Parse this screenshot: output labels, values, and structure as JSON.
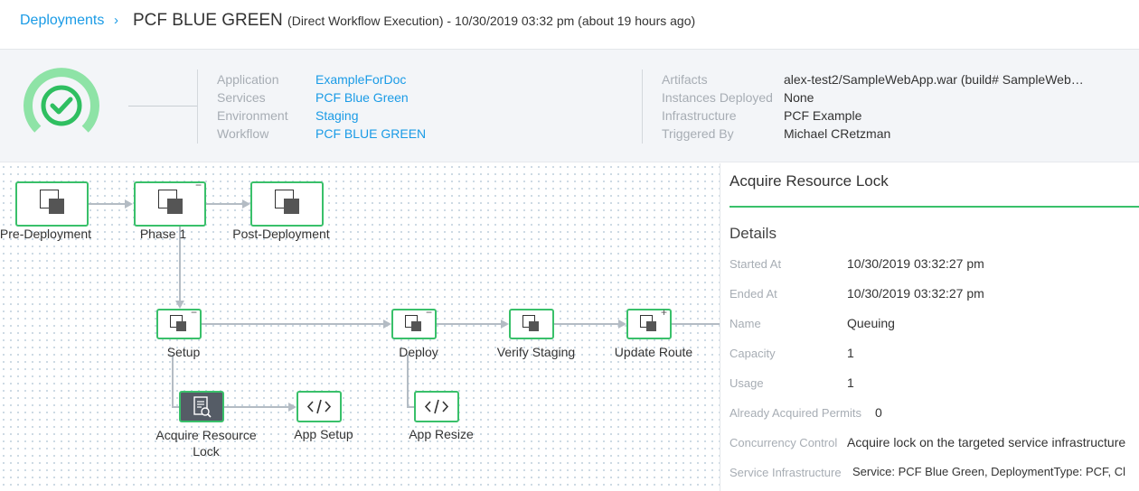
{
  "breadcrumb": {
    "parent": "Deployments",
    "separator": "›"
  },
  "header": {
    "title": "PCF BLUE GREEN",
    "subtitle": "(Direct Workflow Execution) - 10/30/2019 03:32 pm (about 19 hours ago)"
  },
  "summary": {
    "status": "success",
    "left": [
      {
        "label": "Application",
        "value": "ExampleForDoc"
      },
      {
        "label": "Services",
        "value": "PCF Blue Green"
      },
      {
        "label": "Environment",
        "value": "Staging"
      },
      {
        "label": "Workflow",
        "value": "PCF BLUE GREEN"
      }
    ],
    "right": [
      {
        "label": "Artifacts",
        "value": "alex-test2/SampleWebApp.war (build# SampleWeb…"
      },
      {
        "label": "Instances Deployed",
        "value": "None"
      },
      {
        "label": "Infrastructure",
        "value": "PCF Example"
      },
      {
        "label": "Triggered By",
        "value": "Michael CRetzman"
      }
    ]
  },
  "graph": {
    "nodes": {
      "pre_deployment": {
        "label": "Pre-Deployment",
        "icon": "phase-squares-icon"
      },
      "phase1": {
        "label": "Phase 1",
        "indicator": "−",
        "icon": "phase-squares-icon"
      },
      "post_deployment": {
        "label": "Post-Deployment",
        "icon": "phase-squares-icon"
      },
      "setup": {
        "label": "Setup",
        "indicator": "−",
        "icon": "phase-squares-icon"
      },
      "deploy": {
        "label": "Deploy",
        "indicator": "−",
        "icon": "phase-squares-icon"
      },
      "verify_staging": {
        "label": "Verify Staging",
        "icon": "phase-squares-icon"
      },
      "update_route": {
        "label": "Update Route",
        "indicator": "+",
        "icon": "phase-squares-icon"
      },
      "acquire_lock": {
        "label": "Acquire Resource Lock",
        "icon": "resource-lock-icon"
      },
      "app_setup": {
        "label": "App Setup",
        "icon": "code-icon"
      },
      "app_resize": {
        "label": "App Resize",
        "icon": "code-icon"
      }
    },
    "colors": {
      "success": "#39c06a",
      "edge": "#b4bcc4",
      "selected": "#555c66"
    }
  },
  "panel": {
    "title": "Acquire Resource Lock",
    "section": "Details",
    "rows": [
      {
        "label": "Started At",
        "value": "10/30/2019 03:32:27 pm"
      },
      {
        "label": "Ended At",
        "value": "10/30/2019 03:32:27 pm"
      },
      {
        "label": "Name",
        "value": "Queuing"
      },
      {
        "label": "Capacity",
        "value": "1"
      },
      {
        "label": "Usage",
        "value": "1"
      },
      {
        "label": "Already Acquired Permits",
        "value": "0"
      },
      {
        "label": "Concurrency Control",
        "value": "Acquire lock on the targeted service infrastructure"
      },
      {
        "label": "Service Infrastructure",
        "value": "Service: PCF Blue Green, DeploymentType: PCF, Cl"
      }
    ]
  }
}
